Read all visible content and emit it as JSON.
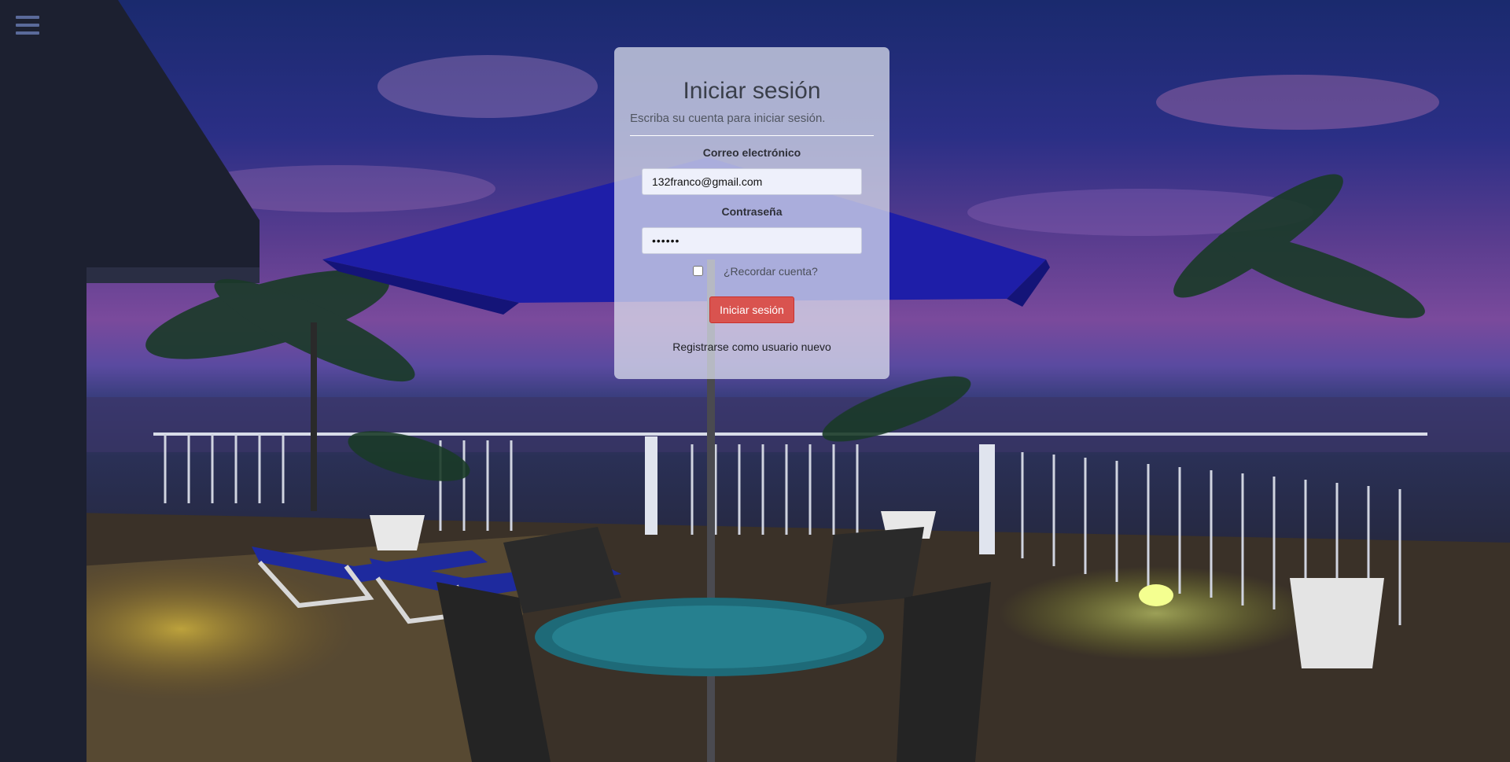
{
  "menu": {
    "icon": "hamburger-menu-icon"
  },
  "login": {
    "title": "Iniciar sesión",
    "subtitle": "Escriba su cuenta para iniciar sesión.",
    "email_label": "Correo electrónico",
    "email_value": "132franco@gmail.com",
    "password_label": "Contraseña",
    "password_value": "••••••",
    "remember_label": "¿Recordar cuenta?",
    "remember_checked": false,
    "submit_label": "Iniciar sesión",
    "register_label": "Registrarse como usuario nuevo"
  },
  "colors": {
    "submit_button": "#d9534f",
    "card_background": "rgba(225,228,240,0.72)"
  }
}
